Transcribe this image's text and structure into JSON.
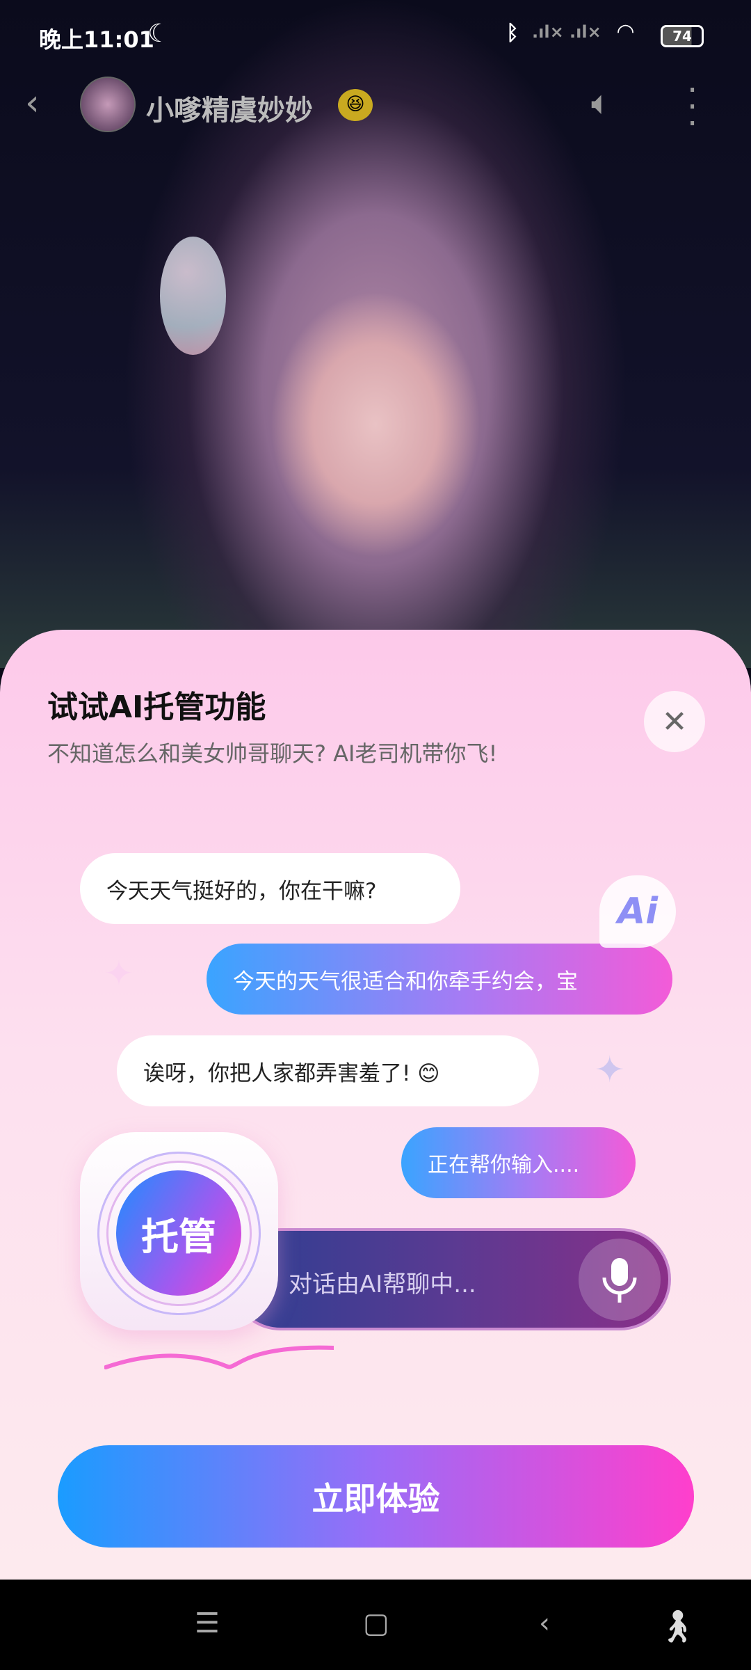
{
  "status_bar": {
    "time": "晚上11:01",
    "battery": "74"
  },
  "header": {
    "contact_name": "小嗲精虞妙妙"
  },
  "promo": {
    "title": "试试AI托管功能",
    "subtitle": "不知道怎么和美女帅哥聊天? AI老司机带你飞!",
    "ai_badge": "Ai",
    "messages": [
      {
        "from": "other",
        "text": "今天天气挺好的，你在干嘛?"
      },
      {
        "from": "ai",
        "text": "今天的天气很适合和你牵手约会，宝"
      },
      {
        "from": "other",
        "text": "诶呀，你把人家都弄害羞了! 😊"
      },
      {
        "from": "ai",
        "text": "正在帮你输入...."
      }
    ],
    "tuoguan_label": "托管",
    "input_status": "对话由AI帮聊中...",
    "cta_label": "立即体验"
  },
  "colors": {
    "gradient_start": "#1a9cff",
    "gradient_mid": "#9b6cf7",
    "gradient_end": "#ff3fcc"
  }
}
